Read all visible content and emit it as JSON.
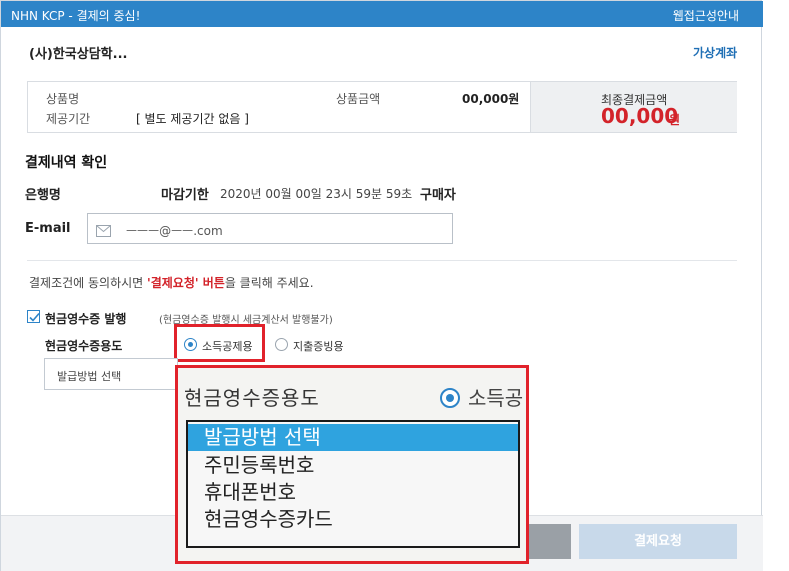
{
  "titlebar": {
    "app_title": "NHN KCP - 결제의 중심!",
    "guide_link": "웹접근성안내"
  },
  "merchant": {
    "name": "(사)한국상담학...",
    "virtual_account_link": "가상계좌"
  },
  "summary": {
    "product_label": "상품명",
    "period_label": "제공기간",
    "period_value": "[ 별도 제공기간 없음 ]",
    "price_label": "상품금액",
    "price_value": "00,000원",
    "final_label": "최종결제금액",
    "final_amount": "00,000",
    "final_unit": "원"
  },
  "payment_check": {
    "section_title": "결제내역 확인",
    "bank_label": "은행명",
    "deadline_label": "마감기한",
    "deadline_value": "2020년 00월 00일 23시 59분 59초",
    "buyer_label": "구매자",
    "email_label": "E-mail",
    "email_value": "ㅡㅡㅡ@ㅡㅡ.com"
  },
  "notice": {
    "prefix": "결제조건에 동의하시면 ",
    "highlight": "'결제요청' 버튼",
    "suffix": "을 클릭해 주세요."
  },
  "cash_receipt": {
    "title": "현금영수증 발행",
    "note": "(현금영수증 발행시 세금계산서 발행불가)",
    "purpose_label": "현금영수증용도",
    "option_income": "소득공제용",
    "option_expense": "지출증빙용",
    "method_select": "발급방법 선택",
    "checked": true,
    "selected_option": "소득공제용"
  },
  "footer": {
    "pay_button": "결제요청"
  },
  "zoom": {
    "title": "현금영수증용도",
    "radio_label": "소득공",
    "options": [
      "발급방법 선택",
      "주민등록번호",
      "휴대폰번호",
      "현금영수증카드"
    ],
    "selected_index": 0
  },
  "colors": {
    "brand_blue": "#2d84c8",
    "highlight_red": "#e1222b",
    "amount_red": "#d3232a",
    "select_blue": "#2fa3df"
  }
}
